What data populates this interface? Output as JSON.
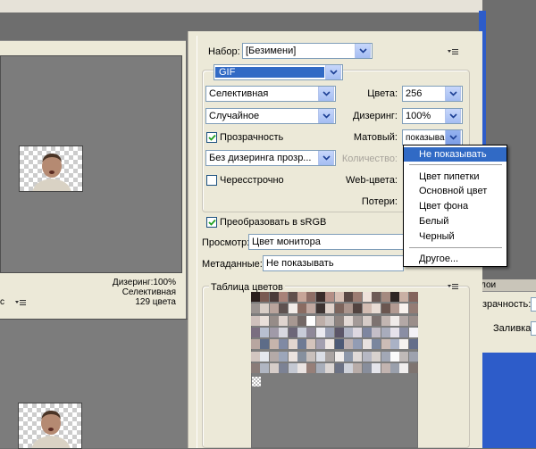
{
  "left": {
    "info_dither": "Дизеринг:100%",
    "info_palette": "Селективная",
    "info_colors": "129 цвета",
    "strip_text": "c"
  },
  "panel": {
    "preset_label": "Набор:",
    "preset_value": "[Безимени]",
    "format_value": "GIF",
    "reduction_value": "Селективная",
    "colors_label": "Цвета:",
    "colors_value": "256",
    "dither_algo_value": "Случайное",
    "dither_label": "Дизеринг:",
    "dither_value": "100%",
    "transparency_label": "Прозрачность",
    "matte_label": "Матовый:",
    "matte_value": "показыва",
    "trans_dither_value": "Без дизеринга прозр...",
    "amount_label": "Количество:",
    "interlaced_label": "Чересстрочно",
    "web_colors_label": "Web-цвета:",
    "loss_label": "Потери:",
    "convert_srgb_label": "Преобразовать в sRGB",
    "preview_label": "Просмотр:",
    "preview_value": "Цвет монитора",
    "metadata_label": "Метаданные:",
    "metadata_value": "Не показывать",
    "color_table_label": "Таблица цветов"
  },
  "dropdown": {
    "items": [
      "Не показывать",
      "Цвет пипетки",
      "Основной цвет",
      "Цвет фона",
      "Белый",
      "Черный",
      "Другое..."
    ]
  },
  "right_panel": {
    "tab_text": "лои",
    "transparency_text": "зрачность:",
    "fill_text": "Заливка:"
  },
  "colors": {
    "selection": "#316ac5",
    "panel_bg": "#ece9d8",
    "canvas_gray": "#7c7c7c",
    "window_blue": "#2d5cc9"
  },
  "swatches": [
    "#2a1e1c",
    "#7a5a52",
    "#4b3a38",
    "#a88278",
    "#61504c",
    "#c7a598",
    "#8e6e66",
    "#3a2c2a",
    "#b48f86",
    "#d8c0b4",
    "#5a4844",
    "#9c7c72",
    "#efe2da",
    "#6d5a55",
    "#a48a80",
    "#2e2624",
    "#c9b0a4",
    "#84645c",
    "#9a9390",
    "#d9cfc8",
    "#b9a49c",
    "#5e5250",
    "#f2ece8",
    "#8a6c62",
    "#c0a8a0",
    "#3e3432",
    "#e0d2ca",
    "#7c645c",
    "#aa948c",
    "#51423f",
    "#d2bcb2",
    "#e8dcd4",
    "#6a5650",
    "#b29a92",
    "#f8f2ee",
    "#947c74",
    "#cfc1bc",
    "#e9e0da",
    "#968c88",
    "#dfd4cf",
    "#a79892",
    "#736866",
    "#ffffff",
    "#bdaea8",
    "#cbc4c2",
    "#8f8480",
    "#e4dad6",
    "#a49a98",
    "#d6ccc8",
    "#7d7270",
    "#c2b6b2",
    "#f0ebe9",
    "#b3a8a6",
    "#9b8e8a",
    "#7a6e80",
    "#b8c0d0",
    "#a09aa8",
    "#d8d8e0",
    "#6c6678",
    "#c8ccd8",
    "#8e8898",
    "#eaeaf0",
    "#9aa0b4",
    "#5c5668",
    "#b0b4c4",
    "#ded8e0",
    "#7e86a0",
    "#c4bec8",
    "#a8acbc",
    "#e6e2ea",
    "#8a8ea4",
    "#f4f2f6",
    "#b8a6a0",
    "#5d6c88",
    "#c6b4ac",
    "#808aa4",
    "#e2d6d0",
    "#6e7a94",
    "#d4c4bc",
    "#a4a0b0",
    "#f0e8e4",
    "#4e5a76",
    "#bcb0b0",
    "#929cb4",
    "#e8e2e0",
    "#7a869e",
    "#ccbcb6",
    "#aab2c6",
    "#f6f2f0",
    "#646e8a",
    "#d2c6c0",
    "#e4e8ee",
    "#b4aaa8",
    "#9ca6ba",
    "#ece4e0",
    "#86909e",
    "#c8c0bc",
    "#dadee6",
    "#aaa4a2",
    "#f2eeec",
    "#8e98aa",
    "#e0dad8",
    "#b6b8c4",
    "#d8d2ce",
    "#a2a8b6",
    "#fafafa",
    "#c0bab8",
    "#9ea2ae",
    "#8a7c78",
    "#b0b6c2",
    "#d6cdc9",
    "#7c8294",
    "#c4c8d2",
    "#eae4e2",
    "#967f78",
    "#a8aeba",
    "#dcd6d4",
    "#6c7284",
    "#cfd2da",
    "#b8aca8",
    "#888e9c",
    "#e4e4ea",
    "#c2b4b0",
    "#9aa0ac",
    "#f0eeee",
    "#7e7470",
    "#cccccc"
  ]
}
